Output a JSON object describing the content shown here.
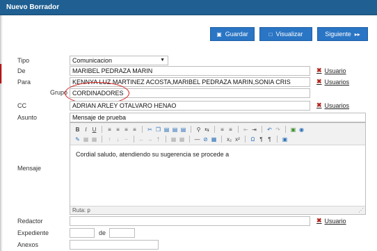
{
  "window": {
    "title": "Nuevo Borrador"
  },
  "buttons": {
    "guardar": {
      "label": "Guardar",
      "icon": "save-icon"
    },
    "visualizar": {
      "label": "Visualizar",
      "icon": "preview-icon"
    },
    "siguiente": {
      "label": "Siguiente",
      "icon": "next-icon"
    }
  },
  "form": {
    "tipo": {
      "label": "Tipo",
      "value": "Comunicacion"
    },
    "de": {
      "label": "De",
      "value": "MARIBEL PEDRAZA MARIN",
      "link": "Usuario"
    },
    "para": {
      "label": "Para",
      "value": "KENNYA LUZ MARTINEZ ACOSTA,MARIBEL PEDRAZA MARIN,SONIA CRIS",
      "link": "Usuarios"
    },
    "grupo": {
      "label": "Grupo",
      "value": "CORDINADORES"
    },
    "cc": {
      "label": "CC",
      "value": "ADRIAN ARLEY OTALVARO HENAO",
      "link": "Usuarios"
    },
    "asunto": {
      "label": "Asunto",
      "value": "Mensaje de prueba"
    },
    "mensaje": {
      "label": "Mensaje",
      "body": "Cordial saludo, atendiendo su sugerencia se procede a",
      "status_path": "Ruta: p"
    },
    "redactor": {
      "label": "Redactor",
      "value": "",
      "link": "Usuario"
    },
    "expediente": {
      "label": "Expediente",
      "value1": "",
      "separator": "de",
      "value2": ""
    },
    "anexos": {
      "label": "Anexos",
      "value": ""
    }
  },
  "colors": {
    "header": "#1f5f92",
    "button": "#2a75c4",
    "remove": "#b3261e",
    "highlight_oval": "#d01818"
  }
}
